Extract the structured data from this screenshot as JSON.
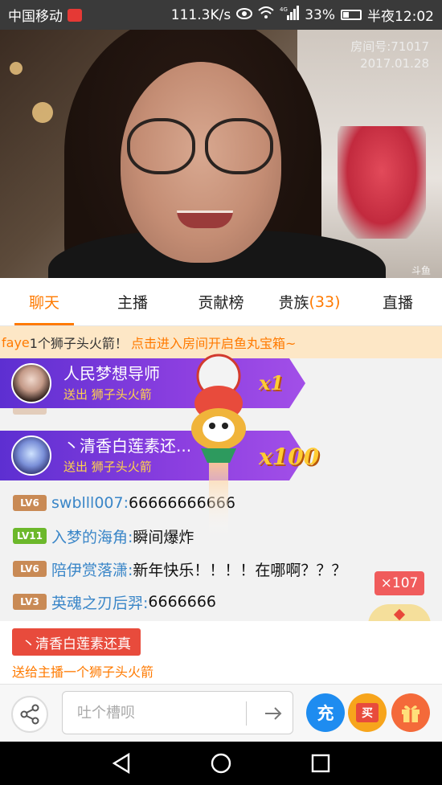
{
  "status_bar": {
    "carrier": "中国移动",
    "speed": "111.3K/s",
    "network": "4G",
    "battery": "33%",
    "battery_level": 0.33,
    "time": "半夜12:02"
  },
  "video": {
    "room_number": "房间号:71017",
    "date": "2017.01.28",
    "watermark": "斗鱼"
  },
  "tabs": [
    {
      "label": "聊天",
      "active": true
    },
    {
      "label": "主播"
    },
    {
      "label": "贡献榜"
    },
    {
      "label": "贵族",
      "count": "(33)"
    },
    {
      "label": "直播"
    }
  ],
  "notice": {
    "user": "faye",
    "text": "1个狮子头火箭！",
    "link": "点击进入房间开启鱼丸宝箱~"
  },
  "gift_banners": [
    {
      "name": "人民梦想导师",
      "sub": "送出 狮子头火箭",
      "multiplier": "x1"
    },
    {
      "name": "丶清香白莲素还...",
      "sub": "送出 狮子头火箭",
      "multiplier": "x100"
    }
  ],
  "messages": [
    {
      "level": "LV6",
      "name": "swblll007:",
      "text": "66666666666"
    },
    {
      "level": "LV11",
      "name": "入梦的海角:",
      "text": "瞬间爆炸"
    },
    {
      "level": "LV6",
      "name": "陪伊赏落潇:",
      "text": "新年快乐！！！！在哪啊？？？"
    },
    {
      "level": "LV3",
      "name": "英魂之刃后羿:",
      "text": "6666666"
    }
  ],
  "combo_badge": "×107",
  "gift_notice": {
    "tag": "丶清香白莲素还真",
    "line": "送给主播一个狮子头火箭"
  },
  "input": {
    "placeholder": "吐个槽呗",
    "charge_label": "充",
    "buy_label": "买"
  },
  "colors": {
    "accent": "#ff7a00",
    "banner_purple": "#7b38dc",
    "name_blue": "#3a86c8",
    "lv_orange": "#c98a55",
    "lv_green": "#6cb82b"
  }
}
